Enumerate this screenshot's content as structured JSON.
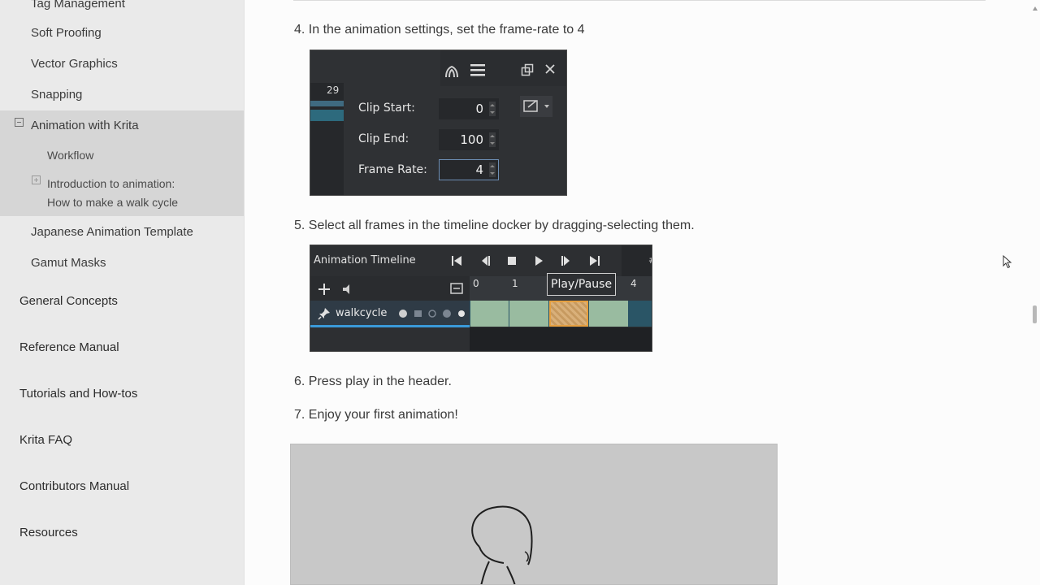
{
  "sidebar": {
    "items_l2_top": [
      {
        "label": "Tag Management"
      },
      {
        "label": "Soft Proofing"
      },
      {
        "label": "Vector Graphics"
      },
      {
        "label": "Snapping"
      }
    ],
    "active_section": {
      "label": "Animation with Krita",
      "children": [
        {
          "label": "Workflow"
        },
        {
          "label_line1": "Introduction to animation:",
          "label_line2": "How to make a walk cycle"
        }
      ]
    },
    "items_l2_bottom": [
      {
        "label": "Japanese Animation Template"
      },
      {
        "label": "Gamut Masks"
      }
    ],
    "items_l1": [
      {
        "label": "General Concepts"
      },
      {
        "label": "Reference Manual"
      },
      {
        "label": "Tutorials and How-tos"
      },
      {
        "label": "Krita FAQ"
      },
      {
        "label": "Contributors Manual"
      },
      {
        "label": "Resources"
      }
    ]
  },
  "main": {
    "steps": [
      {
        "text": "4. In the animation settings, set the frame-rate to 4"
      },
      {
        "text": "5. Select all frames in the timeline docker by dragging-selecting them."
      },
      {
        "text": "6. Press play in the header."
      },
      {
        "text": "7. Enjoy your first animation!"
      }
    ],
    "settings_shot": {
      "frame_number": "29",
      "clip_start_label": "Clip Start:",
      "clip_start_value": "0",
      "clip_end_label": "Clip End:",
      "clip_end_value": "100",
      "frame_rate_label": "Frame Rate:",
      "frame_rate_value": "4"
    },
    "timeline_shot": {
      "title": "Animation Timeline",
      "ruler": [
        "0",
        "1",
        "4"
      ],
      "tooltip": "Play/Pause",
      "layer_name": "walkcycle",
      "hash": "#"
    }
  },
  "colors": {
    "sidebar_bg": "#eaeaea",
    "active_block_bg": "#d6d6d6",
    "timeline_frame": "#99bba0",
    "timeline_selected": "#e6b36d",
    "timeline_accent": "#3a9ad9"
  }
}
